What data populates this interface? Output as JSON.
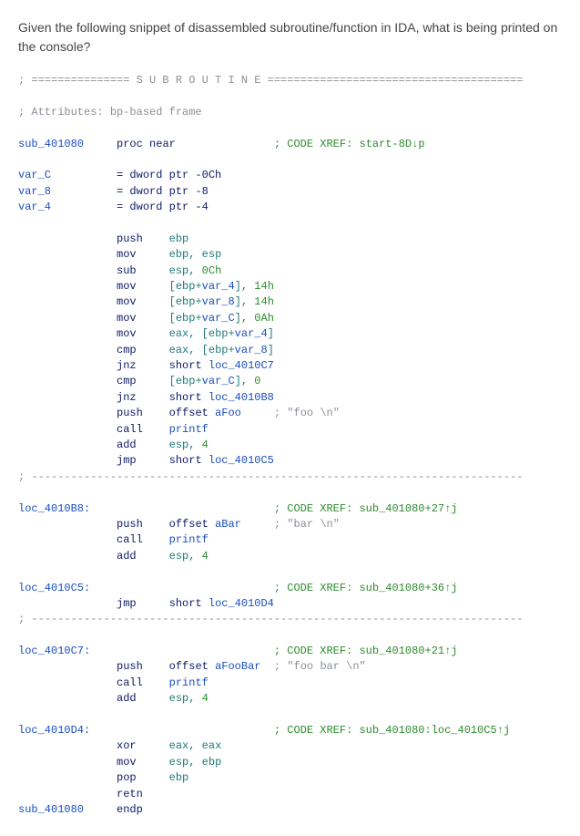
{
  "question": "Given the following snippet of disassembled subroutine/function in IDA, what is being printed on the console?",
  "asm": {
    "hdr_eq": "; =============== S U B R O U T I N E =======================================",
    "attr": "; Attributes: bp-based frame",
    "sub_lbl": "sub_401080",
    "proc_near": "proc near",
    "xref_start": "; CODE XREF: start-8D",
    "down": "↓",
    "p_suffix": "p",
    "var_c_name": "var_C",
    "var_c_def": "= dword ptr -0Ch",
    "var_8_name": "var_8",
    "var_8_def": "= dword ptr -8",
    "var_4_name": "var_4",
    "var_4_def": "= dword ptr -4",
    "i01_op": "push",
    "i01_a": "ebp",
    "i02_op": "mov",
    "i02_a": "ebp, esp",
    "i03_op": "sub",
    "i03_a": "esp, ",
    "i03_b": "0Ch",
    "i04_op": "mov",
    "i04_a": "[ebp+",
    "i04_v": "var_4",
    "i04_c": "], ",
    "i04_n": "14h",
    "i05_op": "mov",
    "i05_a": "[ebp+",
    "i05_v": "var_8",
    "i05_c": "], ",
    "i05_n": "14h",
    "i06_op": "mov",
    "i06_a": "[ebp+",
    "i06_v": "var_C",
    "i06_c": "], ",
    "i06_n": "0Ah",
    "i07_op": "mov",
    "i07_a": "eax, [ebp+",
    "i07_v": "var_4",
    "i07_c": "]",
    "i08_op": "cmp",
    "i08_a": "eax, [ebp+",
    "i08_v": "var_8",
    "i08_c": "]",
    "i09_op": "jnz",
    "i09_a": "short ",
    "i09_t": "loc_4010C7",
    "i10_op": "cmp",
    "i10_a": "[ebp+",
    "i10_v": "var_C",
    "i10_c": "], ",
    "i10_n": "0",
    "i11_op": "jnz",
    "i11_a": "short ",
    "i11_t": "loc_4010B8",
    "i12_op": "push",
    "i12_a": "offset ",
    "i12_t": "aFoo",
    "i12_cm": "; \"foo \\n\"",
    "i13_op": "call",
    "i13_t": "printf",
    "i14_op": "add",
    "i14_a": "esp, ",
    "i14_n": "4",
    "i15_op": "jmp",
    "i15_a": "short ",
    "i15_t": "loc_4010C5",
    "sep": "; ---------------------------------------------------------------------------",
    "lbl_b8": "loc_4010B8:",
    "xref_b8": "; CODE XREF: sub_401080+27",
    "up": "↑",
    "j_suffix": "j",
    "b8_1_op": "push",
    "b8_1_a": "offset ",
    "b8_1_t": "aBar",
    "b8_1_cm": "; \"bar \\n\"",
    "b8_2_op": "call",
    "b8_2_t": "printf",
    "b8_3_op": "add",
    "b8_3_a": "esp, ",
    "b8_3_n": "4",
    "lbl_c5": "loc_4010C5:",
    "xref_c5": "; CODE XREF: sub_401080+36",
    "c5_1_op": "jmp",
    "c5_1_a": "short ",
    "c5_1_t": "loc_4010D4",
    "lbl_c7": "loc_4010C7:",
    "xref_c7": "; CODE XREF: sub_401080+21",
    "c7_1_op": "push",
    "c7_1_a": "offset ",
    "c7_1_t": "aFooBar",
    "c7_1_cm": "; \"foo bar \\n\"",
    "c7_2_op": "call",
    "c7_2_t": "printf",
    "c7_3_op": "add",
    "c7_3_a": "esp, ",
    "c7_3_n": "4",
    "lbl_d4": "loc_4010D4:",
    "xref_d4": "; CODE XREF: sub_401080:loc_4010C5",
    "d4_1_op": "xor",
    "d4_1_a": "eax, eax",
    "d4_2_op": "mov",
    "d4_2_a": "esp, ebp",
    "d4_3_op": "pop",
    "d4_3_a": "ebp",
    "d4_4_op": "retn",
    "endp": "endp"
  }
}
